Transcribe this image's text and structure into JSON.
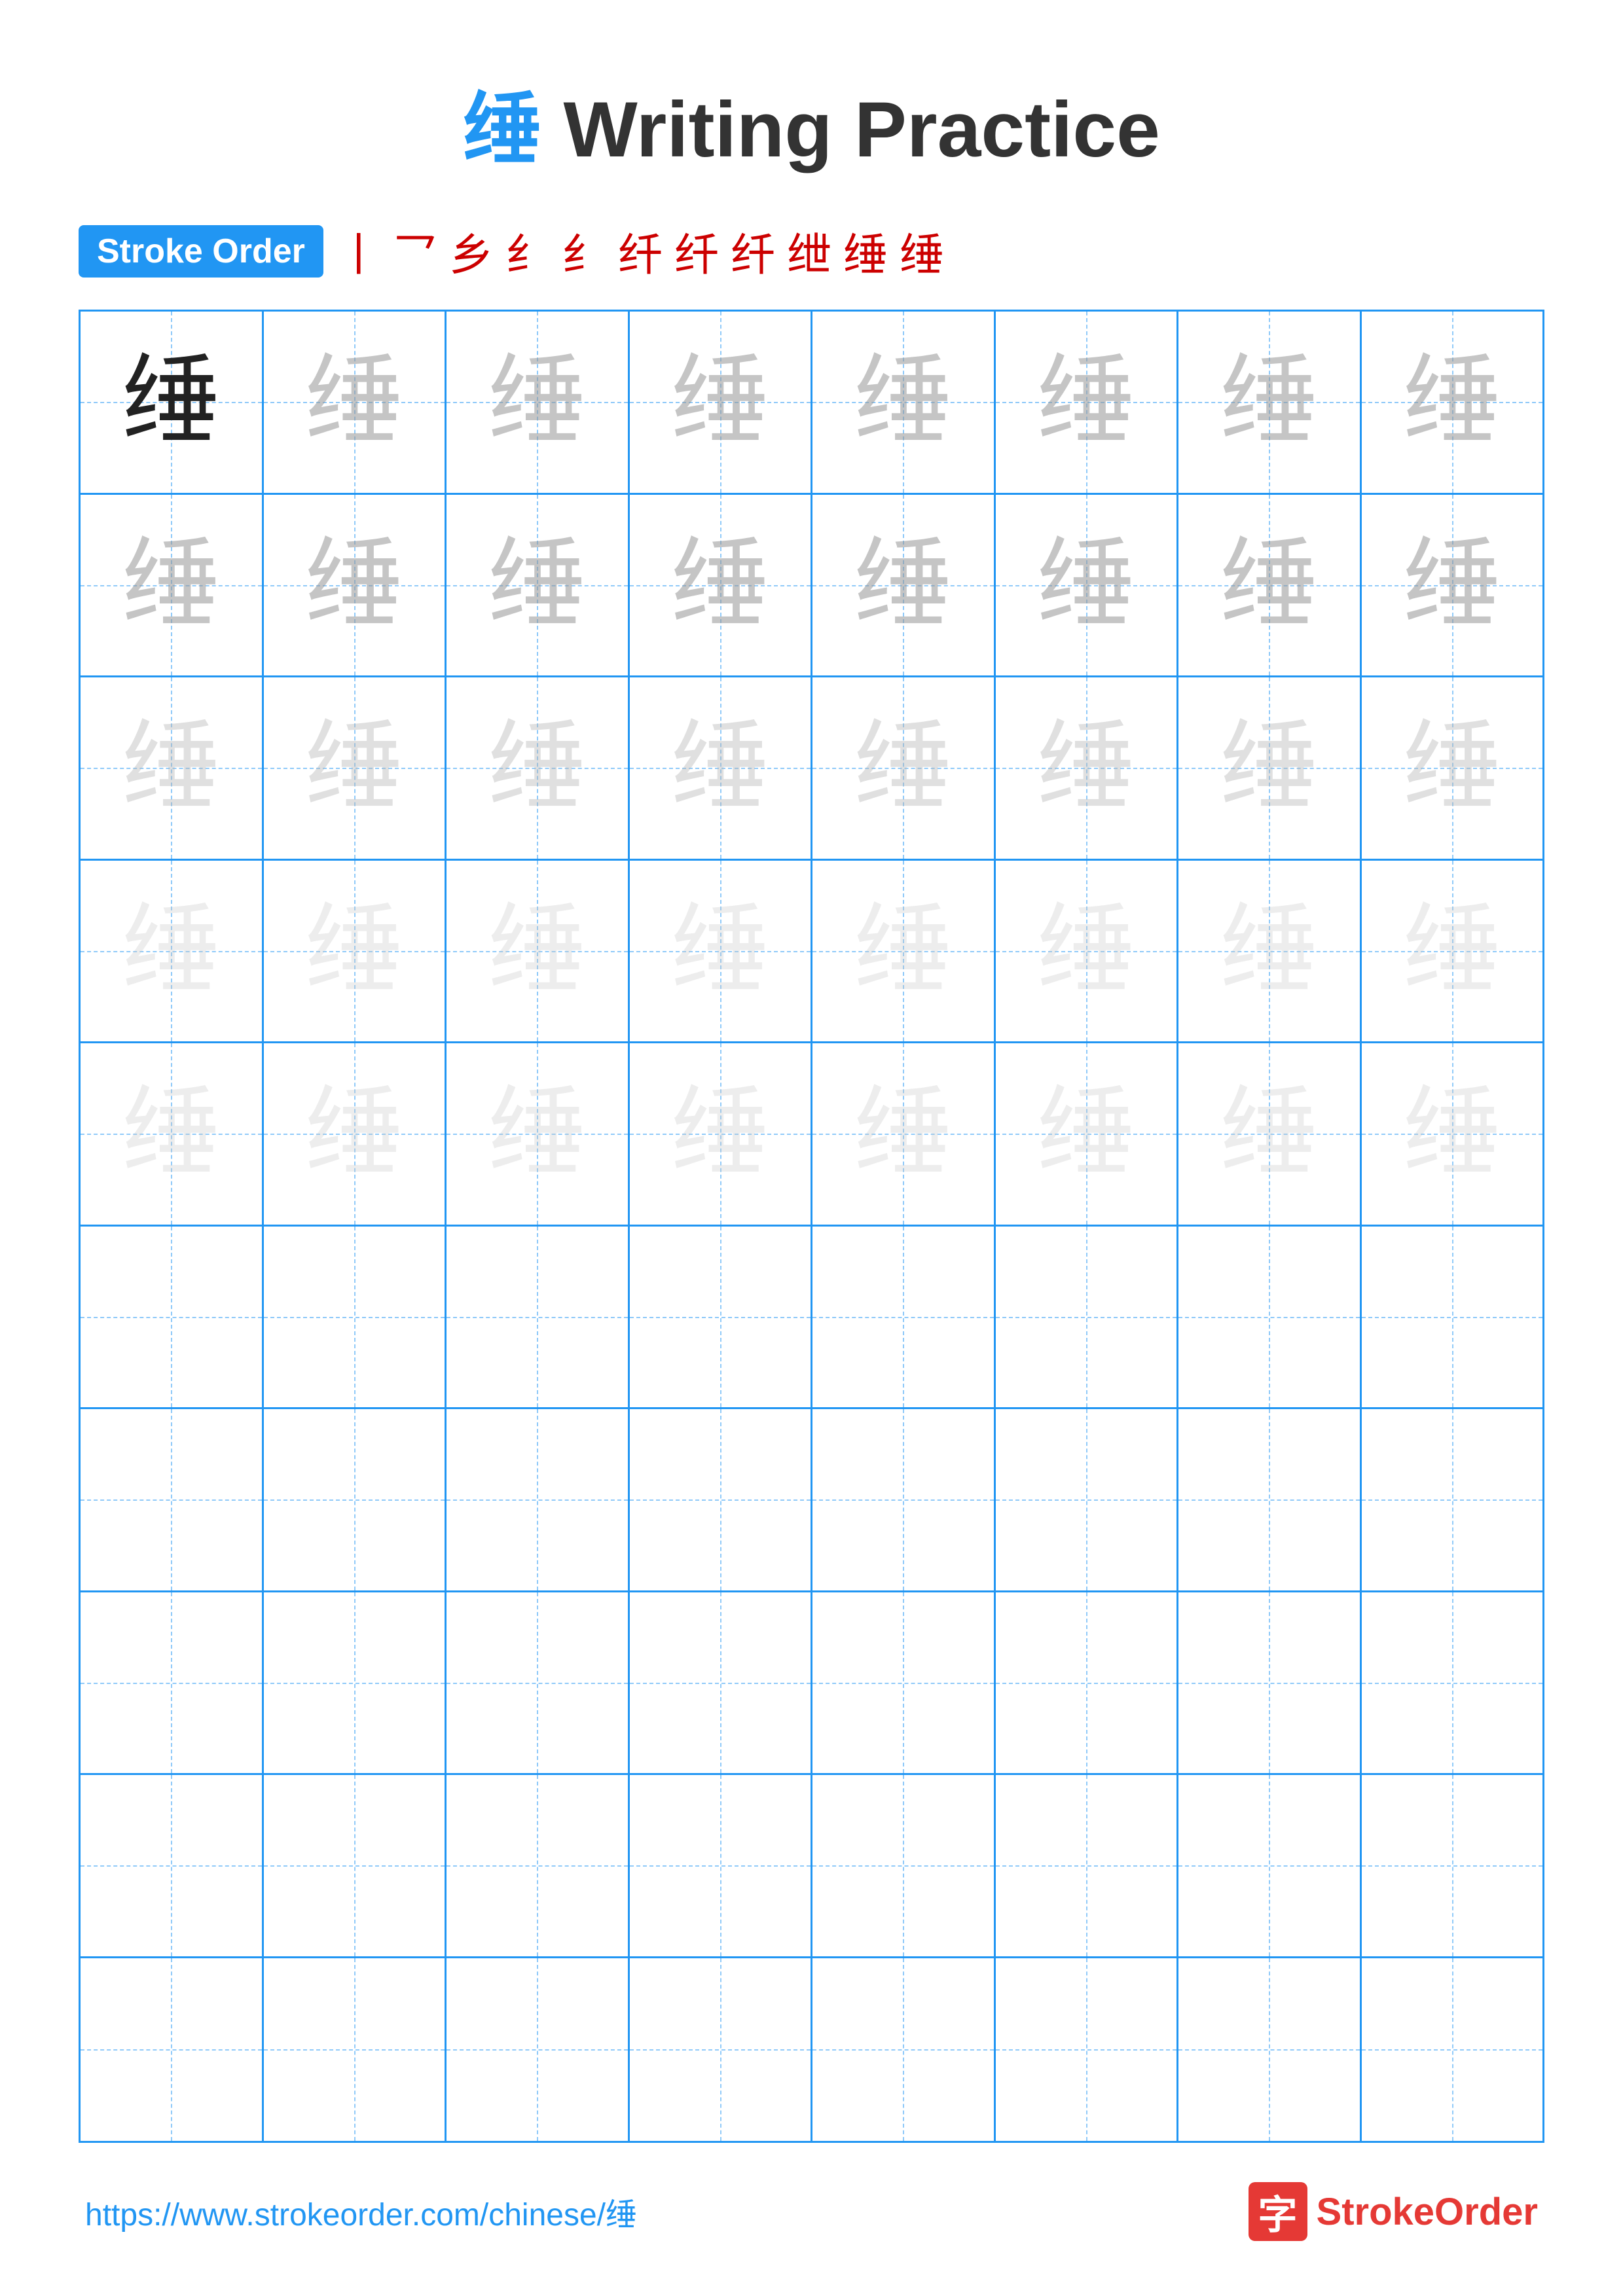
{
  "title": {
    "char": "缍",
    "text": " Writing Practice"
  },
  "stroke_order": {
    "badge_label": "Stroke Order",
    "steps": [
      "丨",
      "乛",
      "乡",
      "纟",
      "纟",
      "纤",
      "纤",
      "纤",
      "绁",
      "缍",
      "缍"
    ]
  },
  "grid": {
    "rows": 10,
    "cols": 8,
    "character": "缍",
    "practice_rows": [
      {
        "type": "dark",
        "count": 8
      },
      {
        "type": "light1",
        "count": 8
      },
      {
        "type": "light2",
        "count": 8
      },
      {
        "type": "light3",
        "count": 8
      },
      {
        "type": "light3",
        "count": 8
      },
      {
        "type": "empty",
        "count": 8
      },
      {
        "type": "empty",
        "count": 8
      },
      {
        "type": "empty",
        "count": 8
      },
      {
        "type": "empty",
        "count": 8
      },
      {
        "type": "empty",
        "count": 8
      }
    ]
  },
  "footer": {
    "url": "https://www.strokeorder.com/chinese/缍",
    "logo_char": "字",
    "logo_text_stroke": "Stroke",
    "logo_text_order": "Order"
  }
}
